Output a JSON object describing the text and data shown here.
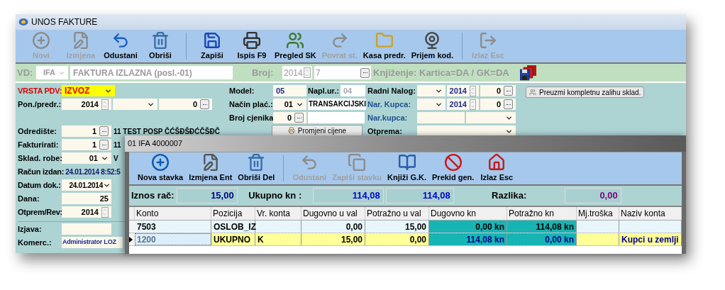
{
  "window": {
    "title": "UNOS FAKTURE"
  },
  "toolbar": [
    {
      "label": "Novi",
      "disabled": true,
      "separator_before": false
    },
    {
      "label": "Izmjena",
      "disabled": true,
      "separator_before": false
    },
    {
      "label": "Odustani",
      "disabled": false,
      "separator_before": false
    },
    {
      "label": "Obriši",
      "disabled": false,
      "separator_before": false
    },
    {
      "label": "Zapiši",
      "disabled": false,
      "separator_before": true
    },
    {
      "label": "Ispis F9",
      "disabled": false,
      "separator_before": false
    },
    {
      "label": "Pregled SK",
      "disabled": false,
      "separator_before": false
    },
    {
      "label": "Povrat st.",
      "disabled": true,
      "separator_before": false
    },
    {
      "label": "Kasa predr.",
      "disabled": false,
      "separator_before": false
    },
    {
      "label": "Prijem kod.",
      "disabled": false,
      "separator_before": false
    },
    {
      "label": "Izlaz Esc",
      "disabled": true,
      "separator_before": true
    }
  ],
  "header": {
    "disabled": true,
    "vd_label": "VD:",
    "doc_type": "IFA",
    "doc_name": "FAKTURA IZLAZNA (posl.-01)",
    "broj_label": "Broj:",
    "year": "2014",
    "number": "7",
    "booking": "Knjiženje: Kartica=DA / GK=DA"
  },
  "form": {
    "vrsta_pdv": {
      "label": "VRSTA PDV:",
      "value": "IZVOZ"
    },
    "pon_predr": {
      "label": "Pon./predr.:",
      "year": "2014",
      "number": "0"
    },
    "odrediste": {
      "label": "Odredište:",
      "code": "1",
      "name": "11 TEST POSP ČĆŠĐŠĐĆČŠĐČ"
    },
    "fakturirati": {
      "label": "Fakturirati:",
      "code": "1",
      "name": "11"
    },
    "sklad": {
      "label": "Sklad. robe:",
      "code": "01",
      "name": "V"
    },
    "racun_izdan": {
      "label": "Račun izdan:",
      "value": "24.01.2014 8:52:5"
    },
    "datum_dok": {
      "label": "Datum dok.:",
      "value": "24.01.2014"
    },
    "dana": {
      "label": "Dana:",
      "value": "25"
    },
    "otprem_rev": {
      "label": "Otprem/Rev:",
      "year": "2014"
    },
    "izjava": {
      "label": "Izjava:"
    },
    "komerc": {
      "label": "Komerc.:",
      "value": "Administrator LOZ"
    },
    "model": {
      "label": "Model:",
      "value": "05"
    },
    "napl_ur": {
      "label": "Napl.ur.:",
      "value": "04",
      "disabled": true
    },
    "nacin_plac": {
      "label": "Način plać.:",
      "code": "01",
      "name": "TRANSAKCIJSKI"
    },
    "broj_cjenika": {
      "label": "Broj cjenika",
      "value": "0"
    },
    "promijeni_button": "Promjeni cijene",
    "radni_nalog": {
      "label": "Radni Nalog:",
      "year": "2014",
      "number": "0"
    },
    "nar_kupca": {
      "label": "Nar. Kupca:",
      "year": "2014",
      "number": "0"
    },
    "nar_kupca_2": {
      "label": "Nar.kupca:"
    },
    "otprema": {
      "label": "Otprema:"
    },
    "preuzmi_button": "Preuzmi kompletnu zalihu sklad."
  },
  "dialog": {
    "title": "01 IFA 4000007",
    "toolbar": [
      {
        "label": "Nova stavka",
        "disabled": false,
        "separator_before": false
      },
      {
        "label": "Izmjena Ent",
        "disabled": false,
        "separator_before": false
      },
      {
        "label": "Obriši Del",
        "disabled": false,
        "separator_before": false
      },
      {
        "label": "Odustani",
        "disabled": true,
        "separator_before": true
      },
      {
        "label": "Zapiši stavku",
        "disabled": true,
        "separator_before": false
      },
      {
        "label": "Knjiži G.K.",
        "disabled": false,
        "separator_before": false
      },
      {
        "label": "Prekid gen.",
        "disabled": false,
        "separator_before": false
      },
      {
        "label": "Izlaz  Esc",
        "disabled": false,
        "separator_before": false
      }
    ],
    "totals": {
      "iznos_label": "Iznos rač:",
      "iznos": "15,00",
      "ukupno_label": "Ukupno kn :",
      "ukupno_1": "114,08",
      "ukupno_2": "114,08",
      "razlika_label": "Razlika:",
      "razlika": "0,00"
    },
    "table": {
      "columns": [
        {
          "label": "Konto",
          "kind": "text"
        },
        {
          "label": "Pozicija",
          "kind": "text"
        },
        {
          "label": "Vr. konta",
          "kind": "text"
        },
        {
          "label": "Dugovno u val",
          "kind": "number"
        },
        {
          "label": "Potražno u val",
          "kind": "number"
        },
        {
          "label": "Dugovno kn",
          "kind": "money"
        },
        {
          "label": "Potražno kn",
          "kind": "money"
        },
        {
          "label": "Mj.troška",
          "kind": "text"
        },
        {
          "label": "Naziv konta",
          "kind": "text"
        }
      ],
      "rows": [
        {
          "selected": false,
          "cells": [
            "7503",
            "OSLOB_IZ",
            null,
            "0,00",
            "15,00",
            "0,00 kn",
            "114,08 kn",
            null,
            null
          ]
        },
        {
          "selected": true,
          "cells": [
            "1200",
            "UKUPNO",
            "K",
            "15,00",
            "0,00",
            "114,08 kn",
            "0,00 kn",
            null,
            "Kupci u zemlji"
          ]
        }
      ]
    }
  }
}
